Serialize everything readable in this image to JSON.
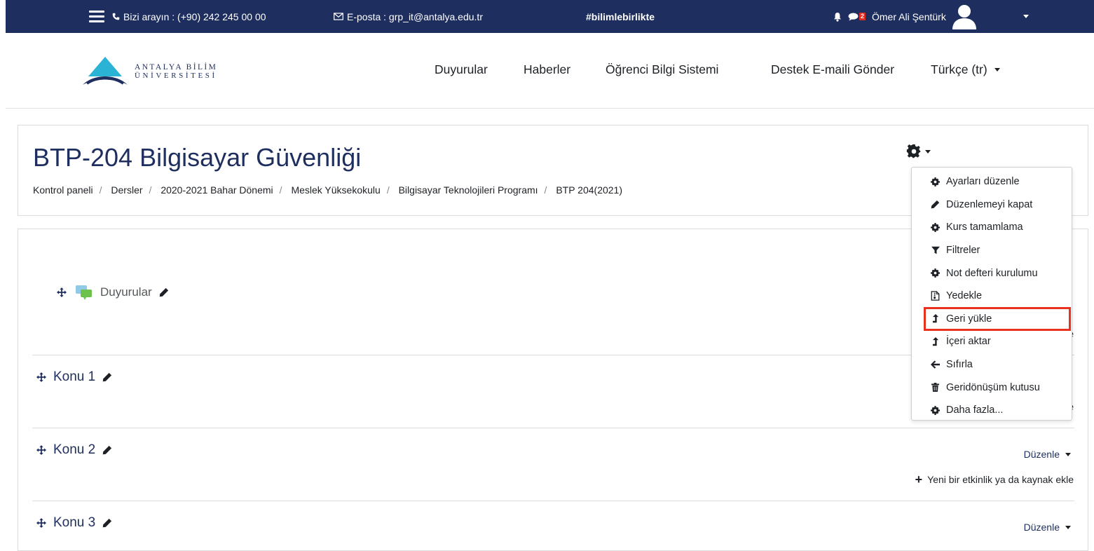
{
  "topbar": {
    "phone": "Bizi arayın : (+90) 242 245 00 00",
    "email": "E-posta : grp_it@antalya.edu.tr",
    "hashtag": "#bilimlebirlikte",
    "messages_badge": "2",
    "user_name": "Ömer Ali Şentürk"
  },
  "logo": {
    "line1": "ANTALYA BİLİM",
    "line2": "ÜNİVERSİTESİ"
  },
  "nav": {
    "items": [
      "Duyurular",
      "Haberler",
      "Öğrenci Bilgi Sistemi",
      "Destek E-maili Gönder"
    ],
    "language": "Türkçe (tr)"
  },
  "course": {
    "title": "BTP-204 Bilgisayar Güvenliği",
    "breadcrumb": [
      "Kontrol paneli",
      "Dersler",
      "2020-2021 Bahar Dönemi",
      "Meslek Yüksekokulu",
      "Bilgisayar Teknolojileri Programı",
      "BTP 204(2021)"
    ]
  },
  "sections": {
    "announcements": "Duyurular",
    "topics": [
      "Konu 1",
      "Konu 2",
      "Konu 3"
    ],
    "edit_label": "Düzenle",
    "add_activity": "Yeni bir etkinlik ya da kaynak ekle",
    "add_activity_truncated": "Ye"
  },
  "admin_menu": {
    "items": [
      "Ayarları düzenle",
      "Düzenlemeyi kapat",
      "Kurs tamamlama",
      "Filtreler",
      "Not defteri kurulumu",
      "Yedekle",
      "Geri yükle",
      "İçeri aktar",
      "Sıfırla",
      "Geridönüşüm kutusu",
      "Daha fazla..."
    ],
    "highlighted": "Geri yükle"
  },
  "colors": {
    "topbar": "#1e2e5f",
    "accent": "#1e2e5f",
    "highlight": "#e8321f",
    "logo_blue": "#2bb3d6"
  }
}
